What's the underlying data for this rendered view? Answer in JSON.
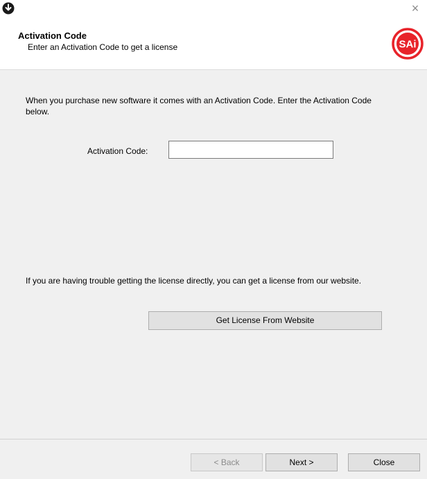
{
  "window": {
    "close_glyph": "×"
  },
  "header": {
    "title": "Activation Code",
    "subtitle": "Enter an Activation Code to get a license",
    "logo_text": "SAi"
  },
  "main": {
    "intro_text": "When you purchase new software it comes with an Activation Code.  Enter the Activation Code below.",
    "code_label": "Activation Code:",
    "code_value": "",
    "help_text": "If you are having trouble getting the license directly, you can get a license from our website.",
    "website_button": "Get License From Website"
  },
  "footer": {
    "back": "< Back",
    "next": "Next >",
    "close": "Close"
  },
  "colors": {
    "accent": "#e8232a",
    "panel_bg": "#f0f0f0",
    "button_bg": "#e1e1e1"
  }
}
